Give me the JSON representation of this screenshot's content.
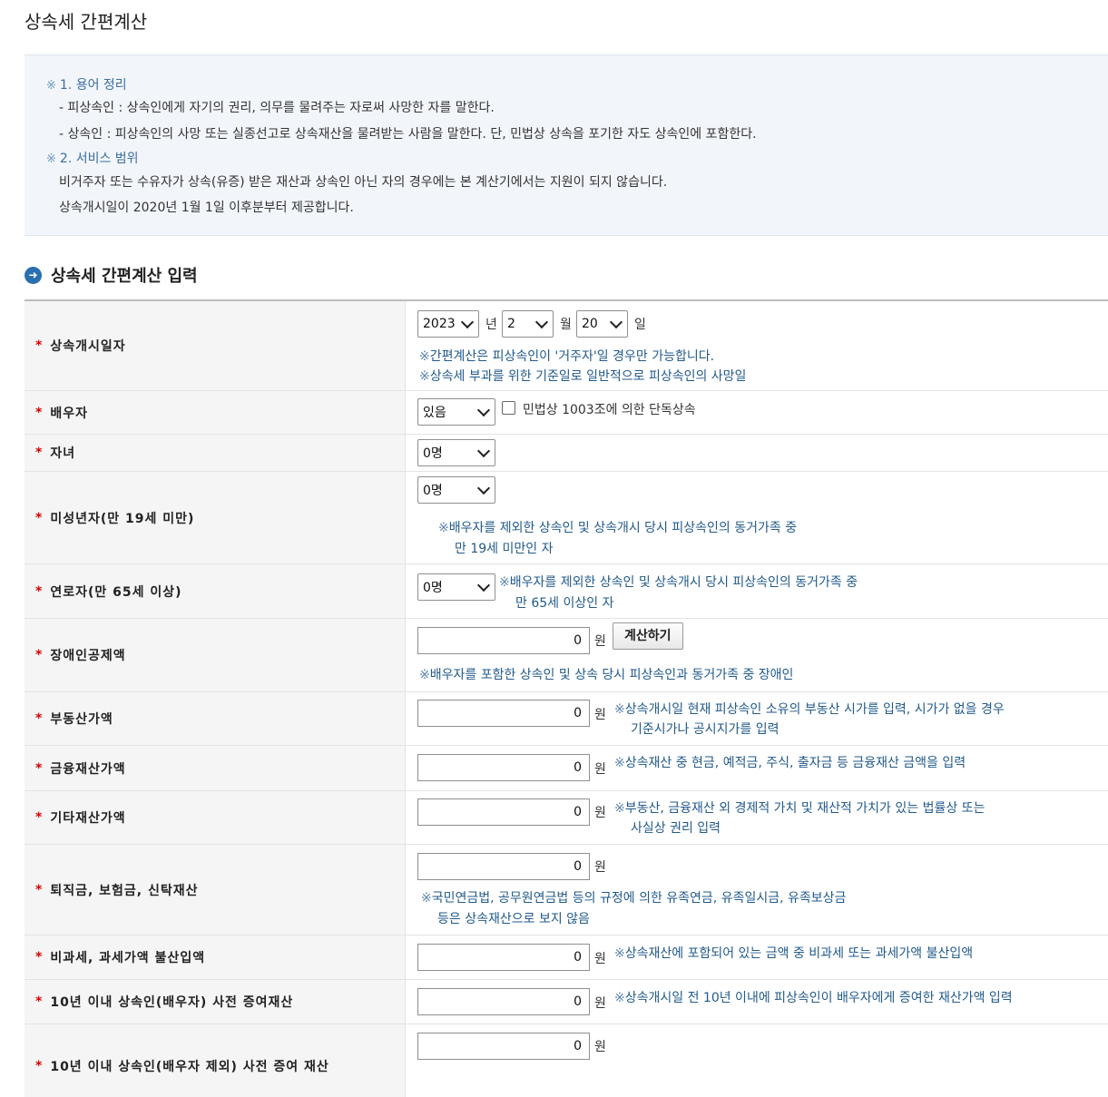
{
  "page_title": "상속세 간편계산",
  "info": {
    "h1": "1. 용어 정리",
    "l1": "- 피상속인 : 상속인에게 자기의 권리, 의무를 물려주는 자로써 사망한 자를 말한다.",
    "l2": "- 상속인 : 피상속인의 사망 또는 실종선고로 상속재산을 물려받는 사람을 말한다. 단, 민법상 상속을 포기한 자도 상속인에 포함한다.",
    "h2": "2. 서비스 범위",
    "l3": "비거주자 또는 수유자가 상속(유증) 받은 재산과 상속인 아닌 자의 경우에는 본 계산기에서는 지원이 되지 않습니다.",
    "l4": "상속개시일이 2020년 1월 1일 이후분부터 제공합니다.",
    "mark": "※"
  },
  "section_title": "상속세 간편계산 입력",
  "required_mark": "*",
  "note_mark": "※",
  "won": "원",
  "rows": {
    "date": {
      "label": "상속개시일자",
      "year": "2023",
      "year_unit": "년",
      "month": "2",
      "month_unit": "월",
      "day": "20",
      "day_unit": "일",
      "note1": "간편계산은 피상속인이 '거주자'일 경우만 가능합니다.",
      "note2": "상속세 부과를 위한 기준일로 일반적으로 피상속인의 사망일"
    },
    "spouse": {
      "label": "배우자",
      "value": "있음",
      "checkbox_label": "민법상 1003조에 의한 단독상속"
    },
    "children": {
      "label": "자녀",
      "value": "0명"
    },
    "minor": {
      "label": "미성년자(만 19세 미만)",
      "value": "0명",
      "note1": "배우자를 제외한 상속인 및 상속개시 당시 피상속인의 동거가족 중",
      "note2": "만 19세 미만인 자"
    },
    "elder": {
      "label": "연로자(만 65세 이상)",
      "value": "0명",
      "note1": "배우자를 제외한 상속인 및 상속개시 당시 피상속인의 동거가족 중",
      "note2": "만 65세 이상인 자"
    },
    "disabled": {
      "label": "장애인공제액",
      "value": "0",
      "button": "계산하기",
      "note1": "배우자를 포함한 상속인 및 상속 당시 피상속인과 동거가족 중 장애인"
    },
    "realestate": {
      "label": "부동산가액",
      "value": "0",
      "note1": "상속개시일 현재 피상속인 소유의 부동산 시가를 입력, 시가가 없을 경우",
      "note2": "기준시가나 공시지가를 입력"
    },
    "financial": {
      "label": "금융재산가액",
      "value": "0",
      "note1": "상속재산 중 현금, 예적금, 주식, 출자금 등 금융재산 금액을 입력"
    },
    "other": {
      "label": "기타재산가액",
      "value": "0",
      "note1": "부동산, 금융재산 외 경제적 가치 및 재산적 가치가 있는 법률상 또는",
      "note2": "사실상 권리 입력"
    },
    "retire": {
      "label": "퇴직금, 보험금, 신탁재산",
      "value": "0",
      "note1": "국민연금법, 공무원연금법 등의 규정에 의한 유족연금, 유족일시금, 유족보상금",
      "note2": "등은 상속재산으로 보지 않음"
    },
    "nontax": {
      "label": "비과세, 과세가액 불산입액",
      "value": "0",
      "note1": "상속재산에 포함되어 있는 금액 중 비과세 또는 과세가액 불산입액"
    },
    "gift_spouse": {
      "label": "10년 이내 상속인(배우자) 사전 증여재산",
      "value": "0",
      "note1": "상속개시일 전 10년 이내에 피상속인이 배우자에게 증여한 재산가액 입력"
    },
    "gift_other": {
      "label": "10년 이내 상속인(배우자 제외) 사전 증여 재산",
      "value": "0"
    }
  }
}
